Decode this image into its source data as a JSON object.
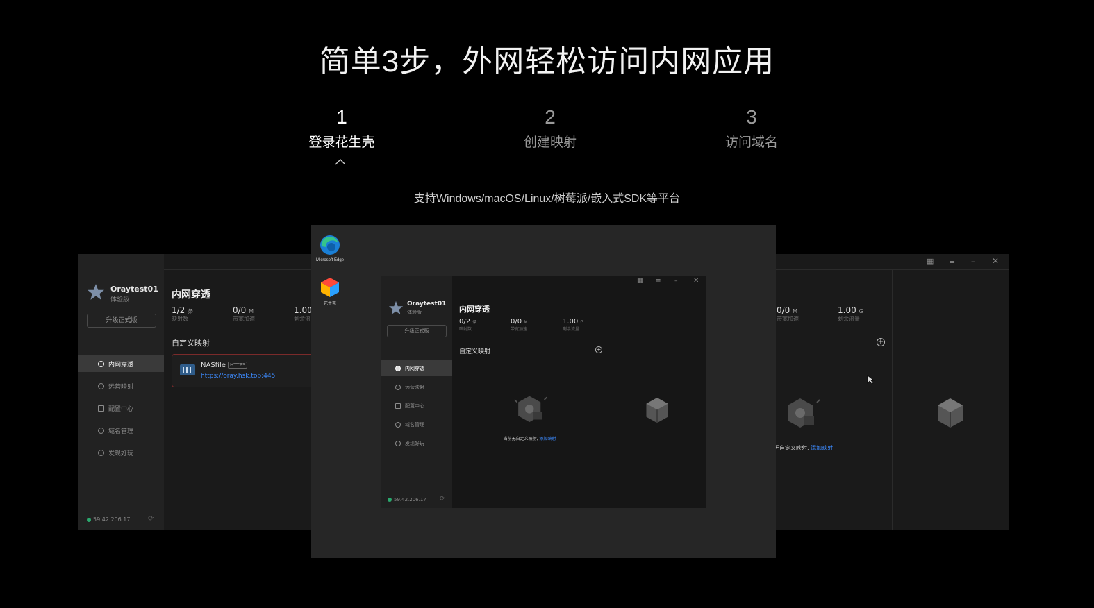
{
  "headline": "简单3步，外网轻松访问内网应用",
  "steps": [
    {
      "num": "1",
      "label": "登录花生壳"
    },
    {
      "num": "2",
      "label": "创建映射"
    },
    {
      "num": "3",
      "label": "访问域名"
    }
  ],
  "subtitle": "支持Windows/macOS/Linux/树莓派/嵌入式SDK等平台",
  "desktop": {
    "icons": [
      {
        "name": "Microsoft Edge"
      },
      {
        "name": "花生壳"
      }
    ]
  },
  "app": {
    "user": "Oraytest01",
    "version": "体验版",
    "upgrade": "升级正式版",
    "nav": [
      "内网穿透",
      "远营映射",
      "配置中心",
      "域名管理",
      "发现好玩"
    ],
    "title": "内网穿透",
    "stats": [
      {
        "value": "0/2",
        "unit": "条",
        "label": "映射数"
      },
      {
        "value": "0/0",
        "unit": "M",
        "label": "带宽加速"
      },
      {
        "value": "1.00",
        "unit": "G",
        "label": "剩余流量"
      }
    ],
    "section": "自定义映射",
    "empty_text": "当前无自定义映射,",
    "empty_link": "添加映射",
    "ip": "59.42.206.17"
  },
  "left_app": {
    "stats": [
      {
        "value": "1/2",
        "unit": "条",
        "label": "映射数"
      },
      {
        "value": "0/0",
        "unit": "M",
        "label": "带宽加速"
      },
      {
        "value": "1.00",
        "unit": "",
        "label": "剩余流"
      }
    ],
    "mapping": {
      "name": "NASfile",
      "badge": "HTTPS",
      "url": "https://oray.hsk.top:445"
    }
  },
  "right_app": {
    "stats": [
      {
        "value": "0/0",
        "unit": "M",
        "label": "带宽加速"
      },
      {
        "value": "1.00",
        "unit": "G",
        "label": "剩余流量"
      }
    ],
    "empty_text": "无自定义映射,",
    "empty_link": "添加映射"
  }
}
